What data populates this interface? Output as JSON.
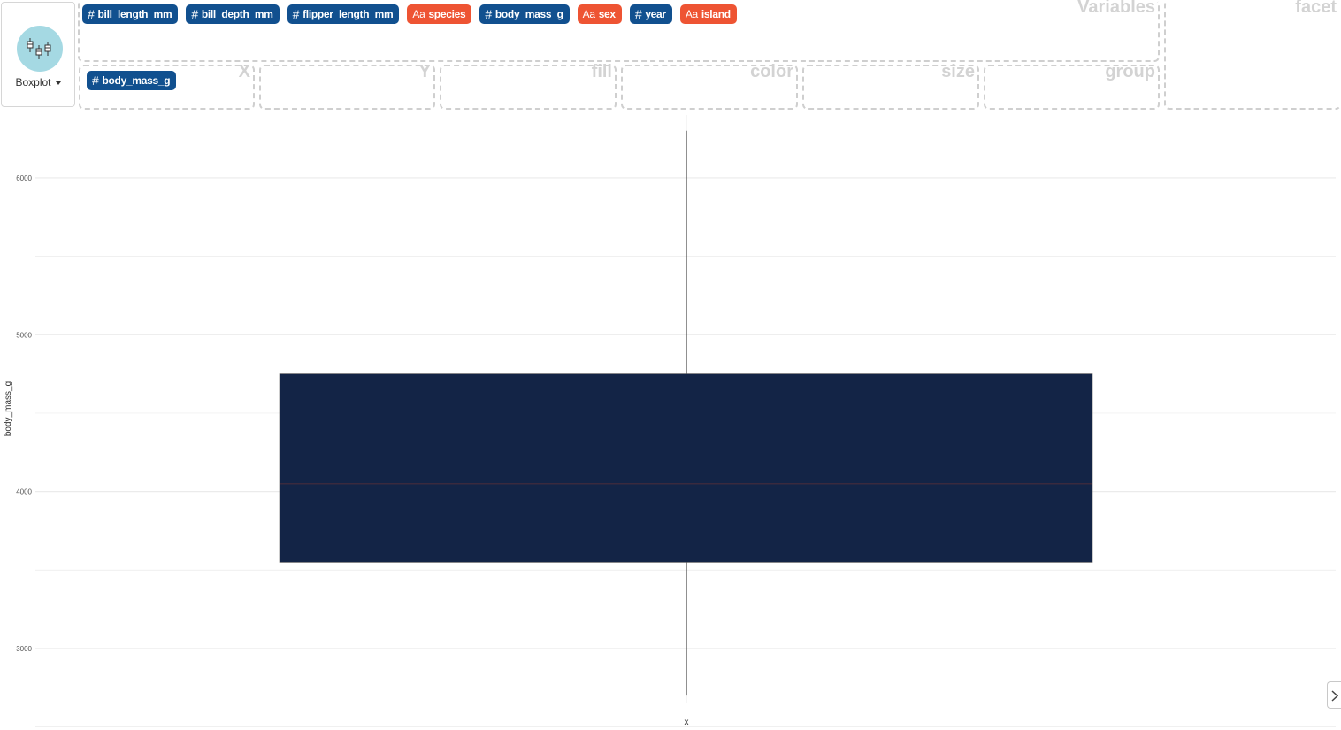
{
  "geom": {
    "label": "Boxplot",
    "icon": "boxplot-icon",
    "icon_bg": "#a5d9e3"
  },
  "variables_zone": {
    "label": "Variables",
    "chips": [
      {
        "name": "bill_length_mm",
        "type": "numeric",
        "glyph": "#"
      },
      {
        "name": "bill_depth_mm",
        "type": "numeric",
        "glyph": "#"
      },
      {
        "name": "flipper_length_mm",
        "type": "numeric",
        "glyph": "#"
      },
      {
        "name": "species",
        "type": "categorical",
        "glyph": "Aa"
      },
      {
        "name": "body_mass_g",
        "type": "numeric",
        "glyph": "#"
      },
      {
        "name": "sex",
        "type": "categorical",
        "glyph": "Aa"
      },
      {
        "name": "year",
        "type": "numeric",
        "glyph": "#"
      },
      {
        "name": "island",
        "type": "categorical",
        "glyph": "Aa"
      }
    ]
  },
  "facet_zone": {
    "label": "facet"
  },
  "mapping_zones": {
    "x": {
      "label": "X",
      "chip": {
        "name": "body_mass_g",
        "glyph": "#"
      }
    },
    "y": {
      "label": "Y"
    },
    "fill": {
      "label": "fill"
    },
    "color": {
      "label": "color"
    },
    "size": {
      "label": "size"
    },
    "group": {
      "label": "group"
    }
  },
  "colors": {
    "numeric_chip": "#11508f",
    "categorical_chip": "#ee5433",
    "box_fill": "#132446",
    "median_line": "#3a2a3e",
    "whisker": "#222222",
    "grid": "#ebebeb"
  },
  "side_toggle": {
    "icon": "chevron-right-icon"
  },
  "chart_data": {
    "type": "boxplot",
    "xlabel": "x",
    "ylabel": "body_mass_g",
    "ylim": [
      2650,
      6400
    ],
    "yticks": [
      3000,
      4000,
      5000,
      6000
    ],
    "grid": true,
    "box": {
      "min": 2700,
      "q1": 3550,
      "median": 4050,
      "q3": 4750,
      "max": 6300
    }
  }
}
